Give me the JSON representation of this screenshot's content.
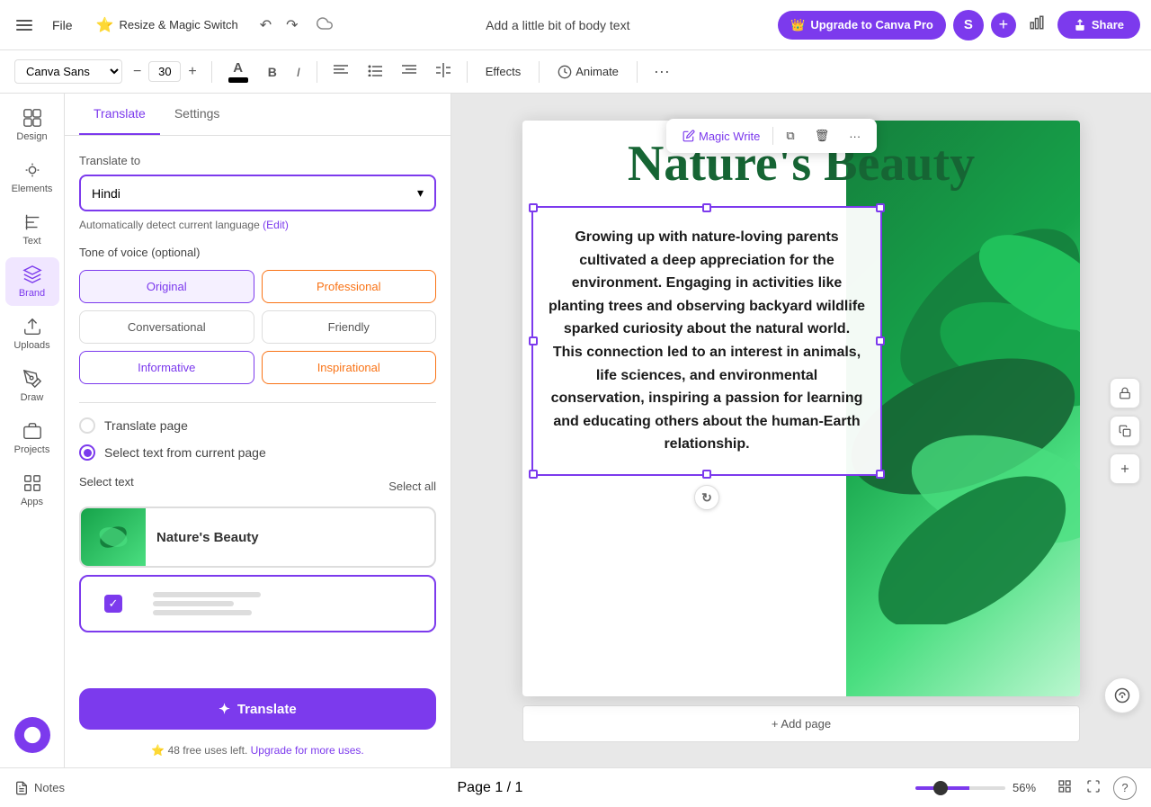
{
  "topbar": {
    "file_label": "File",
    "magic_switch_label": "Resize & Magic Switch",
    "magic_switch_emoji": "⭐",
    "doc_title": "Add a little bit of body text",
    "upgrade_label": "Upgrade to Canva Pro",
    "upgrade_emoji": "👑",
    "user_initial": "S",
    "share_label": "Share",
    "share_icon": "↑"
  },
  "formatbar": {
    "font": "Canva Sans",
    "font_size": "30",
    "effects_label": "Effects",
    "animate_label": "Animate",
    "more_icon": "..."
  },
  "sidebar": {
    "items": [
      {
        "id": "design",
        "label": "Design",
        "icon": "design"
      },
      {
        "id": "elements",
        "label": "Elements",
        "icon": "elements"
      },
      {
        "id": "text",
        "label": "Text",
        "icon": "text"
      },
      {
        "id": "brand",
        "label": "Brand",
        "icon": "brand",
        "active": true
      },
      {
        "id": "uploads",
        "label": "Uploads",
        "icon": "uploads"
      },
      {
        "id": "draw",
        "label": "Draw",
        "icon": "draw"
      },
      {
        "id": "projects",
        "label": "Projects",
        "icon": "projects"
      },
      {
        "id": "apps",
        "label": "Apps",
        "icon": "apps"
      }
    ]
  },
  "panel": {
    "tabs": [
      {
        "id": "translate",
        "label": "Translate",
        "active": true
      },
      {
        "id": "settings",
        "label": "Settings",
        "active": false
      }
    ],
    "translate_to_label": "Translate to",
    "selected_language": "Hindi",
    "auto_detect_text": "Automatically detect current language",
    "auto_detect_link": "(Edit)",
    "tone_label": "Tone of voice (optional)",
    "tones": [
      {
        "id": "original",
        "label": "Original",
        "active": true
      },
      {
        "id": "professional",
        "label": "Professional",
        "active": false
      },
      {
        "id": "conversational",
        "label": "Conversational",
        "active": false
      },
      {
        "id": "friendly",
        "label": "Friendly",
        "active": false
      },
      {
        "id": "informative",
        "label": "Informative",
        "active": false
      },
      {
        "id": "inspirational",
        "label": "Inspirational",
        "active": false
      }
    ],
    "translate_page_label": "Translate page",
    "select_text_label": "Select text from current page",
    "select_text_section": "Select text",
    "select_all_label": "Select all",
    "text_items": [
      {
        "id": "natures-beauty",
        "label": "Nature's Beauty",
        "selected": false
      },
      {
        "id": "body-text",
        "label": "",
        "selected": true
      }
    ],
    "translate_btn_label": "Translate",
    "translate_btn_icon": "✦",
    "free_uses_text": "48 free uses left.",
    "upgrade_link": "Upgrade for more uses."
  },
  "canvas": {
    "slide_title": "Nature's Beauty",
    "slide_body": "Growing up with nature-loving parents cultivated a deep appreciation for the environment. Engaging in activities like planting trees and observing backyard wildlife sparked curiosity about the natural world. This connection led to an interest in animals, life sciences, and environmental conservation, inspiring a passion for learning and educating others about the human-Earth relationship.",
    "float_toolbar": {
      "magic_write_label": "Magic Write",
      "copy_icon": "⧉",
      "delete_icon": "🗑",
      "more_icon": "···"
    }
  },
  "bottombar": {
    "notes_label": "Notes",
    "page_info": "Page 1 / 1",
    "zoom_value": "56%"
  },
  "colors": {
    "accent": "#7c3aed",
    "green_dark": "#166534",
    "green_mid": "#16a34a"
  }
}
